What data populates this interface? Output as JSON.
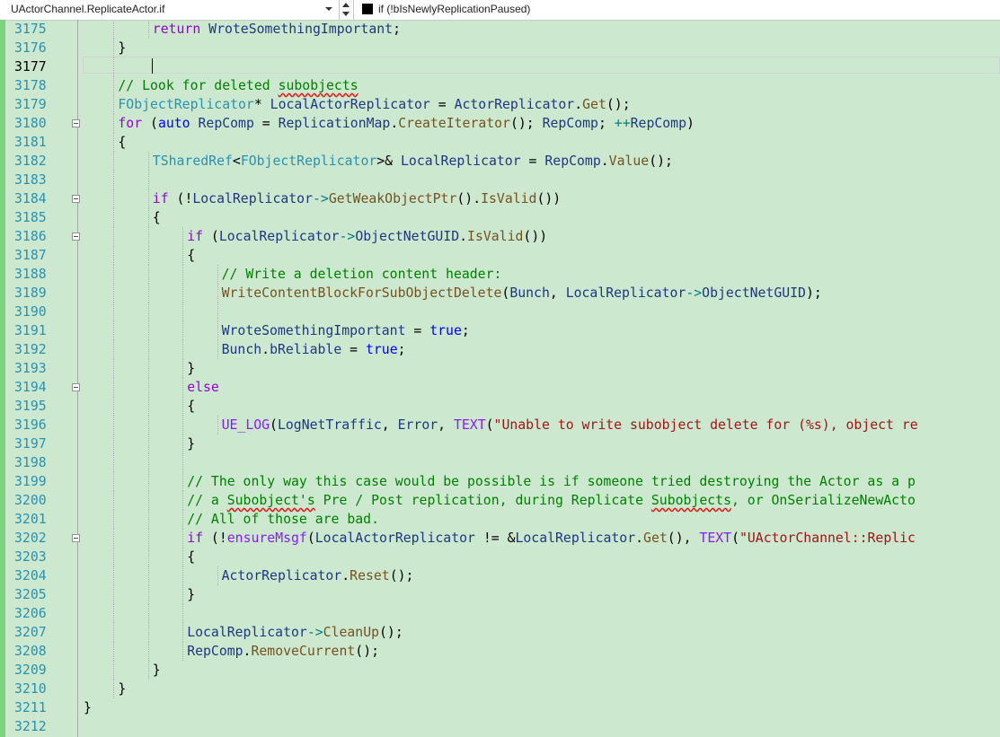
{
  "toolbar": {
    "scope_combo": "UActorChannel.ReplicateActor.if",
    "member_combo": "if (!bIsNewlyReplicationPaused)"
  },
  "colors": {
    "editor_background": "#cce8cf",
    "line_number": "#2b91af",
    "keyword": "#0000ff",
    "comment": "#008000",
    "string": "#a31515",
    "type": "#2b91af",
    "change_track": "#7fd27f"
  },
  "editor": {
    "current_line": "3177",
    "lines": [
      {
        "n": "3175",
        "indent": 3,
        "html": "<span class='kw2'>return</span> <span class='var'>WroteSomethingImportant</span>;"
      },
      {
        "n": "3176",
        "indent": 2,
        "html": "}"
      },
      {
        "n": "3177",
        "indent": 2,
        "html": ""
      },
      {
        "n": "3178",
        "indent": 2,
        "html": "<span class='cm'>// Look for deleted <span class='sq'>subobjects</span></span>"
      },
      {
        "n": "3179",
        "indent": 2,
        "html": "<span class='ty'>FObjectReplicator</span>* <span class='var'>LocalActorReplicator</span> = <span class='var'>ActorReplicator</span>.<span class='fn'>Get</span>();"
      },
      {
        "n": "3180",
        "indent": 2,
        "fold": true,
        "html": "<span class='kw2'>for</span> (<span class='kw'>auto</span> <span class='var'>RepComp</span> = <span class='var'>ReplicationMap</span>.<span class='fn'>CreateIterator</span>(); <span class='var'>RepComp</span>; <span class='op'>++</span><span class='var'>RepComp</span>)"
      },
      {
        "n": "3181",
        "indent": 2,
        "html": "{"
      },
      {
        "n": "3182",
        "indent": 3,
        "html": "<span class='ty'>TSharedRef</span>&lt;<span class='ty'>FObjectReplicator</span>&gt;&amp; <span class='var'>LocalReplicator</span> = <span class='var'>RepComp</span>.<span class='fn'>Value</span>();"
      },
      {
        "n": "3183",
        "indent": 3,
        "html": ""
      },
      {
        "n": "3184",
        "indent": 3,
        "fold": true,
        "html": "<span class='kw2'>if</span> (!<span class='var'>LocalReplicator</span><span class='op'>-&gt;</span><span class='fn'>GetWeakObjectPtr</span>().<span class='fn'>IsValid</span>())"
      },
      {
        "n": "3185",
        "indent": 3,
        "html": "{"
      },
      {
        "n": "3186",
        "indent": 4,
        "fold": true,
        "html": "<span class='kw2'>if</span> (<span class='var'>LocalReplicator</span><span class='op'>-&gt;</span><span class='var'>ObjectNetGUID</span>.<span class='fn'>IsValid</span>())"
      },
      {
        "n": "3187",
        "indent": 4,
        "html": "{"
      },
      {
        "n": "3188",
        "indent": 5,
        "html": "<span class='cm'>// Write a deletion content header:</span>"
      },
      {
        "n": "3189",
        "indent": 5,
        "html": "<span class='fn'>WriteContentBlockForSubObjectDelete</span>(<span class='var'>Bunch</span>, <span class='var'>LocalReplicator</span><span class='op'>-&gt;</span><span class='var'>ObjectNetGUID</span>);"
      },
      {
        "n": "3190",
        "indent": 5,
        "html": ""
      },
      {
        "n": "3191",
        "indent": 5,
        "html": "<span class='var'>WroteSomethingImportant</span> = <span class='kw'>true</span>;"
      },
      {
        "n": "3192",
        "indent": 5,
        "html": "<span class='var'>Bunch</span>.<span class='var'>bReliable</span> = <span class='kw'>true</span>;"
      },
      {
        "n": "3193",
        "indent": 4,
        "html": "}"
      },
      {
        "n": "3194",
        "indent": 4,
        "fold": true,
        "html": "<span class='kw2'>else</span>"
      },
      {
        "n": "3195",
        "indent": 4,
        "html": "{"
      },
      {
        "n": "3196",
        "indent": 5,
        "html": "<span class='mac'>UE_LOG</span>(<span class='var'>LogNetTraffic</span>, <span class='var'>Error</span>, <span class='mac'>TEXT</span>(<span class='st'>\"Unable to write subobject delete for (%s), object re</span>"
      },
      {
        "n": "3197",
        "indent": 4,
        "html": "}"
      },
      {
        "n": "3198",
        "indent": 4,
        "html": ""
      },
      {
        "n": "3199",
        "indent": 4,
        "html": "<span class='cm'>// The only way this case would be possible is if someone tried destroying the Actor as a p</span>"
      },
      {
        "n": "3200",
        "indent": 4,
        "html": "<span class='cm'>// a <span class='sq'>Subobject's</span> Pre / Post replication, during Replicate <span class='sq'>Subobjects</span>, or OnSerializeNewActo</span>"
      },
      {
        "n": "3201",
        "indent": 4,
        "html": "<span class='cm'>// All of those are bad.</span>"
      },
      {
        "n": "3202",
        "indent": 4,
        "fold": true,
        "html": "<span class='kw2'>if</span> (!<span class='mac'>ensureMsgf</span>(<span class='var'>LocalActorReplicator</span> != &amp;<span class='var'>LocalReplicator</span>.<span class='fn'>Get</span>(), <span class='mac'>TEXT</span>(<span class='st'>\"UActorChannel::Replic</span>"
      },
      {
        "n": "3203",
        "indent": 4,
        "html": "{"
      },
      {
        "n": "3204",
        "indent": 5,
        "html": "<span class='var'>ActorReplicator</span>.<span class='fn'>Reset</span>();"
      },
      {
        "n": "3205",
        "indent": 4,
        "html": "}"
      },
      {
        "n": "3206",
        "indent": 4,
        "html": ""
      },
      {
        "n": "3207",
        "indent": 4,
        "html": "<span class='var'>LocalReplicator</span><span class='op'>-&gt;</span><span class='fn'>CleanUp</span>();"
      },
      {
        "n": "3208",
        "indent": 4,
        "html": "<span class='var'>RepComp</span>.<span class='fn'>RemoveCurrent</span>();"
      },
      {
        "n": "3209",
        "indent": 3,
        "html": "}"
      },
      {
        "n": "3210",
        "indent": 2,
        "html": "}"
      },
      {
        "n": "3211",
        "indent": 1,
        "html": "}"
      },
      {
        "n": "3212",
        "indent": 1,
        "html": ""
      }
    ]
  }
}
